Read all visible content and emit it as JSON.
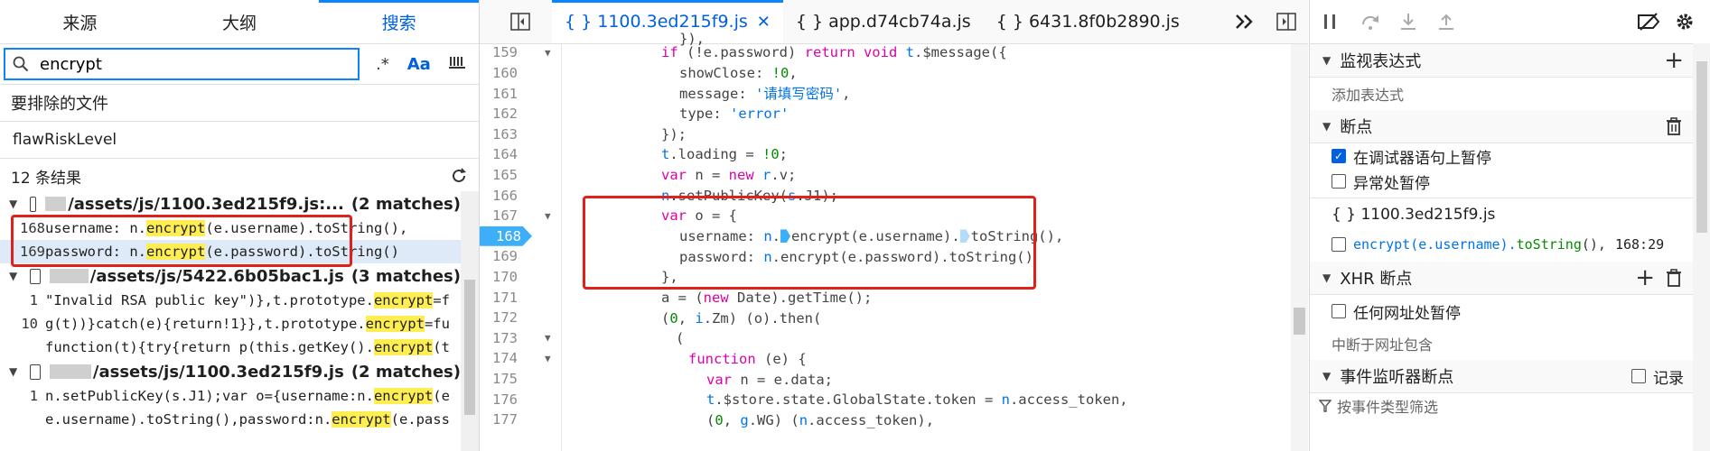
{
  "left": {
    "tabs": [
      "来源",
      "大纲",
      "搜索"
    ],
    "active_tab": 2,
    "search": {
      "value": "encrypt",
      "regex_label": ".*",
      "case_label": "Aa",
      "whole_word_label": "\"\""
    },
    "exclude_label": "要排除的文件",
    "exclude_value": "flawRiskLevel",
    "results_count": "12 条结果",
    "results": [
      {
        "type": "file",
        "name": "/assets/js/1100.3ed215f9.js:...",
        "count": "(2 matches)"
      },
      {
        "type": "match",
        "line": "168",
        "pre": "username: n.",
        "hit": "encrypt",
        "post": "(e.username).toString(),",
        "sel": false
      },
      {
        "type": "match",
        "line": "169",
        "pre": "password: n.",
        "hit": "encrypt",
        "post": "(e.password).toString()",
        "sel": true
      },
      {
        "type": "file",
        "name": "/assets/js/5422.6b05bac1.js",
        "count": "(3 matches)"
      },
      {
        "type": "match",
        "line": "1",
        "pre": "\"Invalid RSA public key\")},t.prototype.",
        "hit": "encrypt",
        "post": "=f",
        "sel": false
      },
      {
        "type": "match",
        "line": "10",
        "pre": "g(t))}catch(e){return!1}},t.prototype.",
        "hit": "encrypt",
        "post": "=fu",
        "sel": false
      },
      {
        "type": "match",
        "line": "",
        "pre": "function(t){try{return p(this.getKey().",
        "hit": "encrypt",
        "post": "(t",
        "sel": false
      },
      {
        "type": "file",
        "name": "/assets/js/1100.3ed215f9.js",
        "count": "(2 matches)"
      },
      {
        "type": "match",
        "line": "1",
        "pre": "n.setPublicKey(s.J1);var o={username:n.",
        "hit": "encrypt",
        "post": "(e",
        "sel": false
      },
      {
        "type": "match",
        "line": "",
        "pre": "e.username).toString(),password:n.",
        "hit": "encrypt",
        "post": "(e.pass",
        "sel": false
      }
    ]
  },
  "editor": {
    "tabs": [
      {
        "label": "{ } 1100.3ed215f9.js",
        "active": true,
        "close": "✕"
      },
      {
        "label": "{ } app.d74cb74a.js",
        "active": false
      },
      {
        "label": "{ } 6431.8f0b2890.js",
        "active": false
      }
    ],
    "lines": [
      {
        "n": "159",
        "fold": true
      },
      {
        "n": "160"
      },
      {
        "n": "161"
      },
      {
        "n": "162"
      },
      {
        "n": "163"
      },
      {
        "n": "164"
      },
      {
        "n": "165"
      },
      {
        "n": "166"
      },
      {
        "n": "167",
        "fold": true
      },
      {
        "n": "168",
        "bp": true
      },
      {
        "n": "169"
      },
      {
        "n": "170"
      },
      {
        "n": "171"
      },
      {
        "n": "172"
      },
      {
        "n": "173",
        "fold": true
      },
      {
        "n": "174",
        "fold": true
      },
      {
        "n": "175"
      },
      {
        "n": "176"
      },
      {
        "n": "177"
      }
    ]
  },
  "right": {
    "watch": {
      "title": "监视表达式",
      "placeholder": "添加表达式"
    },
    "breakpoints": {
      "title": "断点",
      "pause_debugger": "在调试器语句上暂停",
      "pause_exceptions": "异常处暂停",
      "file": "{ } 1100.3ed215f9.js",
      "bp_code_pre": "encrypt(e.username).",
      "bp_code_fn": "toString",
      "bp_code_post": "(),",
      "bp_location": "168:29"
    },
    "xhr": {
      "title": "XHR 断点",
      "any_url": "任何网址处暂停",
      "url_contains": "中断于网址包含"
    },
    "events": {
      "title": "事件监听器断点",
      "log_label": "记录",
      "filter_placeholder": "按事件类型筛选"
    }
  },
  "colors": {
    "accent": "#0060df",
    "highlight": "#ffee52",
    "breakpoint": "#3daff9",
    "annotation": "#e0201b"
  }
}
